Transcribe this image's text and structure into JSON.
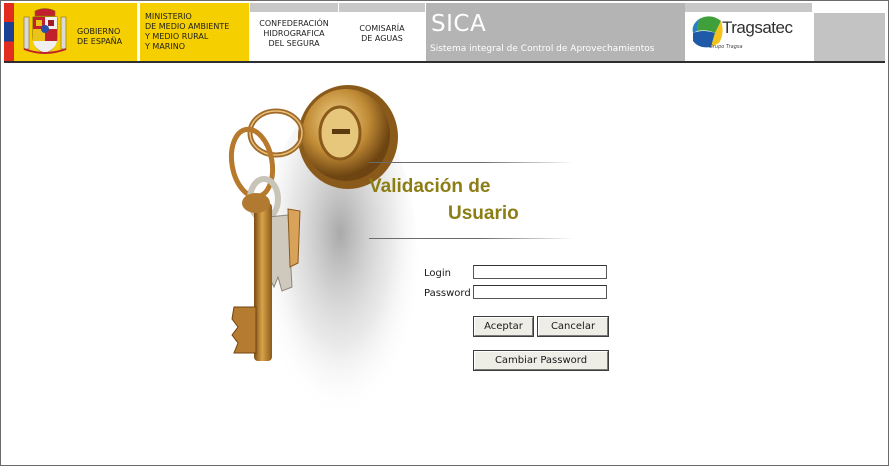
{
  "header": {
    "gobierno": {
      "line1": "GOBIERNO",
      "line2": "DE ESPAÑA"
    },
    "ministerio": {
      "lines": [
        "MINISTERIO",
        "DE MEDIO AMBIENTE",
        "Y MEDIO RURAL",
        "Y MARINO"
      ]
    },
    "confederacion": {
      "lines": [
        "CONFEDERACIÓN",
        "HIDROGRAFICA",
        "DEL SEGURA"
      ]
    },
    "comisaria": {
      "lines": [
        "COMISARÍA",
        "DE AGUAS"
      ]
    },
    "sica": {
      "title": "SICA",
      "subtitle": "Sistema integral de Control de Aprovechamientos"
    },
    "tragsatec": {
      "name": "Tragsatec",
      "grupo": "Grupo Tragsa"
    }
  },
  "login": {
    "title_line1": "Validación de",
    "title_line2": "Usuario",
    "login_label": "Login",
    "login_value": "",
    "password_label": "Password",
    "password_value": "",
    "accept_label": "Aceptar",
    "cancel_label": "Cancelar",
    "change_password_label": "Cambiar Password"
  },
  "colors": {
    "title": "#8c7e14",
    "header_yellow": "#f6cf00",
    "sica_gray": "#b4b4b4"
  }
}
